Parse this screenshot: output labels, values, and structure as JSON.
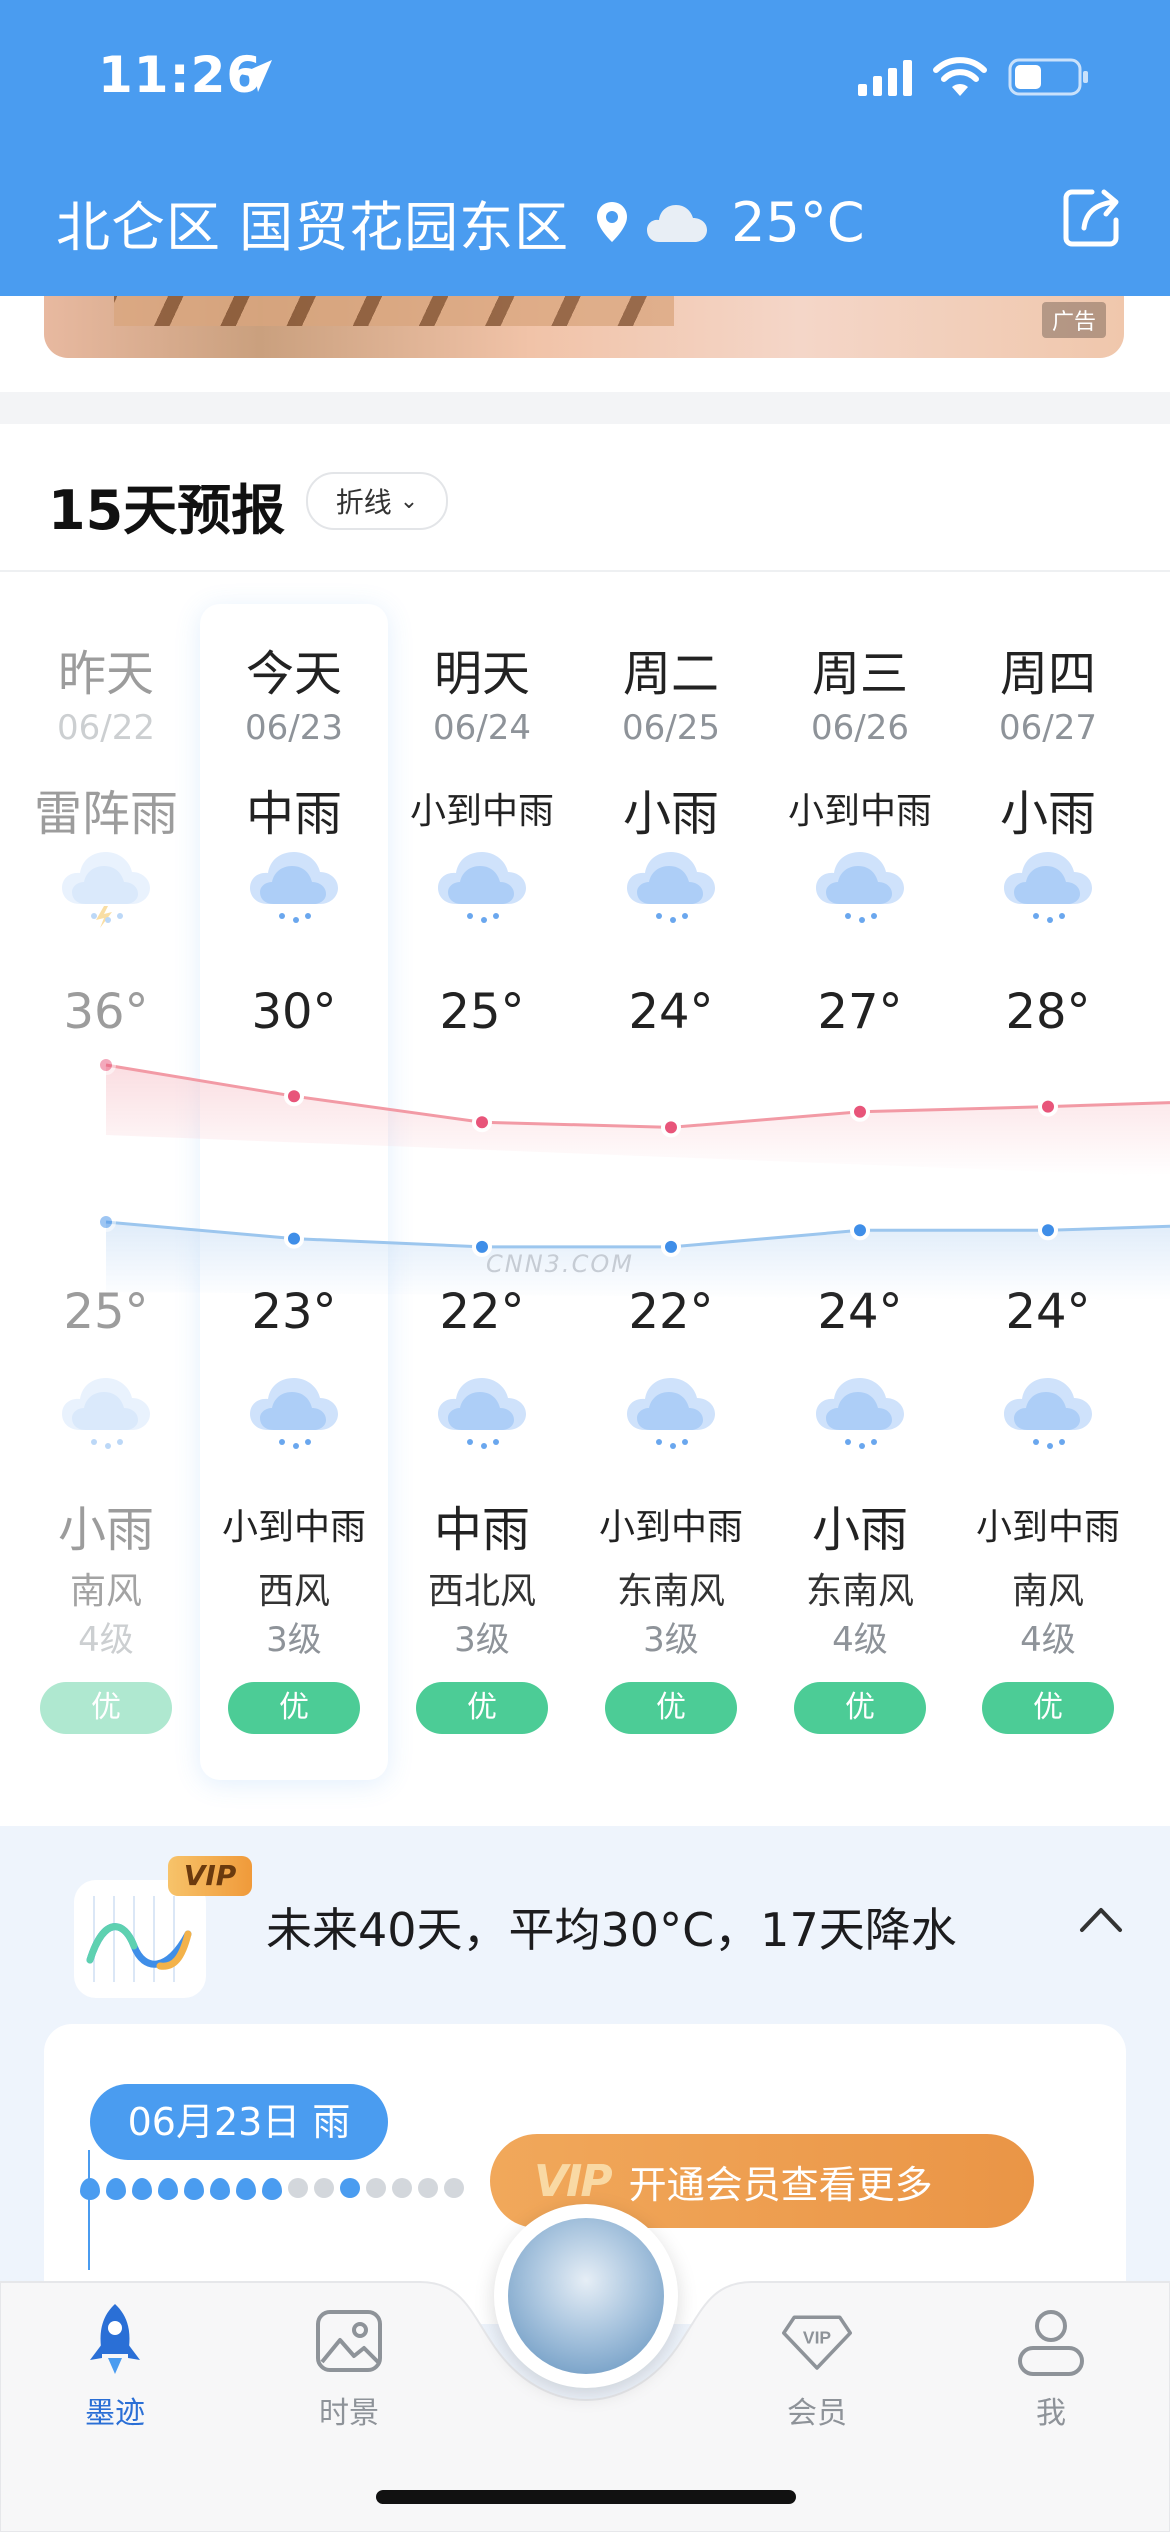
{
  "status": {
    "time": "11:26"
  },
  "header": {
    "location": "北仑区 国贸花园东区",
    "current_temp": "25°C",
    "icons": [
      "location-arrow-icon",
      "signal-icon",
      "wifi-icon",
      "battery-icon",
      "pin-icon",
      "cloud-icon",
      "share-icon"
    ]
  },
  "ad": {
    "tag": "广告"
  },
  "forecast": {
    "title": "15天预报",
    "view_toggle": "折线",
    "days": [
      {
        "name": "昨天",
        "date": "06/22",
        "day_weather": "雷阵雨",
        "high": "36°",
        "low": "25°",
        "night_weather": "小雨",
        "wind": "南风",
        "wind_level": "4级",
        "aqi": "优"
      },
      {
        "name": "今天",
        "date": "06/23",
        "day_weather": "中雨",
        "high": "30°",
        "low": "23°",
        "night_weather": "小到中雨",
        "wind": "西风",
        "wind_level": "3级",
        "aqi": "优"
      },
      {
        "name": "明天",
        "date": "06/24",
        "day_weather": "小到中雨",
        "high": "25°",
        "low": "22°",
        "night_weather": "中雨",
        "wind": "西北风",
        "wind_level": "3级",
        "aqi": "优"
      },
      {
        "name": "周二",
        "date": "06/25",
        "day_weather": "小雨",
        "high": "24°",
        "low": "22°",
        "night_weather": "小到中雨",
        "wind": "东南风",
        "wind_level": "3级",
        "aqi": "优"
      },
      {
        "name": "周三",
        "date": "06/26",
        "day_weather": "小到中雨",
        "high": "27°",
        "low": "24°",
        "night_weather": "小雨",
        "wind": "东南风",
        "wind_level": "4级",
        "aqi": "优"
      },
      {
        "name": "周四",
        "date": "06/27",
        "day_weather": "小雨",
        "high": "28°",
        "low": "24°",
        "night_weather": "小到中雨",
        "wind": "南风",
        "wind_level": "4级",
        "aqi": "优"
      }
    ],
    "high_values": [
      36,
      30,
      25,
      24,
      27,
      28
    ],
    "low_values": [
      25,
      23,
      22,
      22,
      24,
      24
    ],
    "colors": {
      "high_line": "#f29aa5",
      "high_dot": "#e8557a",
      "low_line": "#9cc6ee",
      "low_dot": "#3f8ee8",
      "aqi_good": "#4ccc96"
    }
  },
  "watermark": "CNN3.COM",
  "long_range": {
    "badge": "VIP",
    "summary": "未来40天，平均30°C，17天降水",
    "date_pill": "06月23日 雨",
    "rain_days_shown": 8,
    "dry_days_shown": 7,
    "cta": "开通会员查看更多",
    "cta_badge": "VIP"
  },
  "tabs": [
    {
      "label": "墨迹",
      "icon": "rocket-icon",
      "active": true
    },
    {
      "label": "时景",
      "icon": "photo-icon",
      "active": false
    },
    {
      "label": "会员",
      "icon": "vip-diamond-icon",
      "active": false
    },
    {
      "label": "我",
      "icon": "profile-icon",
      "active": false
    }
  ]
}
